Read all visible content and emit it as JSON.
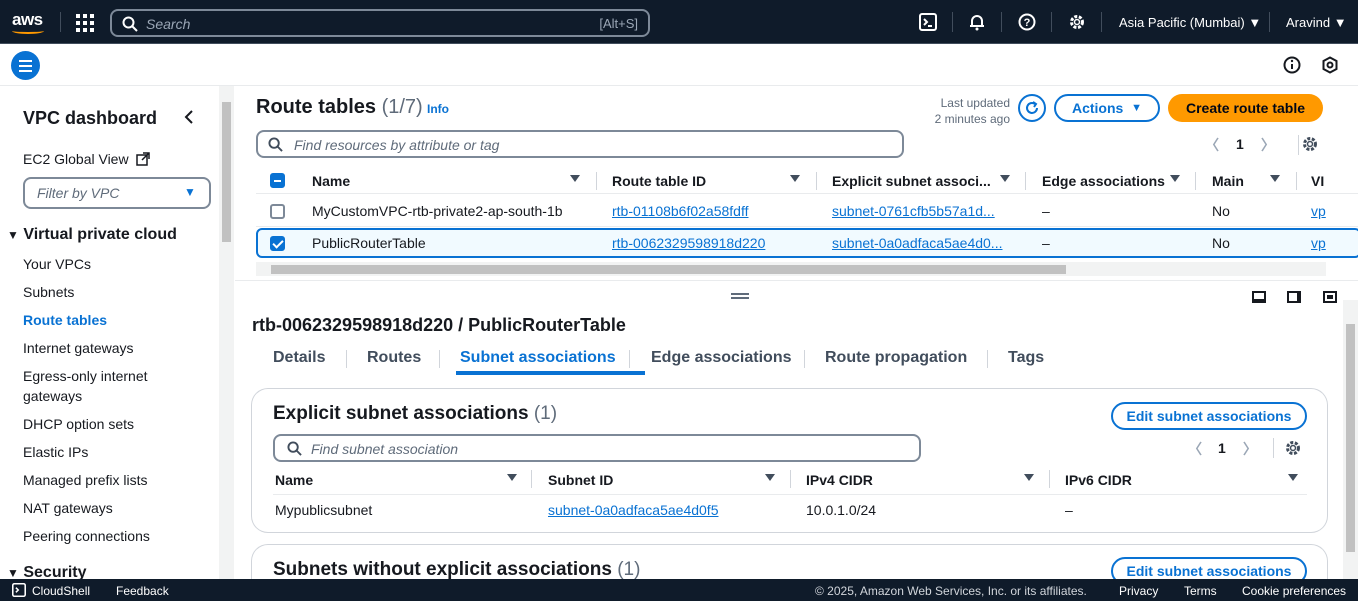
{
  "topnav": {
    "logo": "aws",
    "search_placeholder": "Search",
    "search_shortcut": "[Alt+S]",
    "region": "Asia Pacific (Mumbai)",
    "user": "Aravind",
    "icons": [
      "services-grid-icon",
      "cloudshell-icon",
      "bell-icon",
      "help-icon",
      "gear-icon"
    ]
  },
  "sidebar": {
    "title": "VPC dashboard",
    "ec2_global": "EC2 Global View",
    "filter_placeholder": "Filter by VPC",
    "section_vpc": "Virtual private cloud",
    "items": [
      "Your VPCs",
      "Subnets",
      "Route tables",
      "Internet gateways",
      "Egress-only internet",
      "gateways",
      "DHCP option sets",
      "Elastic IPs",
      "Managed prefix lists",
      "NAT gateways",
      "Peering connections"
    ],
    "active": "Route tables",
    "section_security": "Security"
  },
  "route_tables": {
    "title": "Route tables",
    "count": "(1/7)",
    "info": "Info",
    "last_updated_1": "Last updated",
    "last_updated_2": "2 minutes ago",
    "actions": "Actions",
    "create": "Create route table",
    "search_placeholder": "Find resources by attribute or tag",
    "page": "1",
    "columns": [
      "Name",
      "Route table ID",
      "Explicit subnet associ...",
      "Edge associations",
      "Main",
      "VI"
    ],
    "rows": [
      {
        "name": "MyCustomVPC-rtb-private2-ap-south-1b",
        "id": "rtb-01108b6f02a58fdff",
        "subnet": "subnet-0761cfb5b57a1d...",
        "edge": "–",
        "main": "No",
        "vpc": "vp"
      },
      {
        "name": "PublicRouterTable",
        "id": "rtb-0062329598918d220",
        "subnet": "subnet-0a0adfaca5ae4d0...",
        "edge": "–",
        "main": "No",
        "vpc": "vp"
      }
    ]
  },
  "detail": {
    "title": "rtb-0062329598918d220 / PublicRouterTable",
    "tabs": [
      "Details",
      "Routes",
      "Subnet associations",
      "Edge associations",
      "Route propagation",
      "Tags"
    ],
    "active_tab": "Subnet associations",
    "explicit": {
      "title": "Explicit subnet associations",
      "count": "(1)",
      "edit": "Edit subnet associations",
      "search_placeholder": "Find subnet association",
      "page": "1",
      "columns": [
        "Name",
        "Subnet ID",
        "IPv4 CIDR",
        "IPv6 CIDR"
      ],
      "rows": [
        {
          "name": "Mypublicsubnet",
          "subnet": "subnet-0a0adfaca5ae4d0f5",
          "ipv4": "10.0.1.0/24",
          "ipv6": "–"
        }
      ]
    },
    "without": {
      "title": "Subnets without explicit associations",
      "count": "(1)",
      "edit": "Edit subnet associations"
    }
  },
  "footer": {
    "cloudshell": "CloudShell",
    "feedback": "Feedback",
    "copyright": "© 2025, Amazon Web Services, Inc. or its affiliates.",
    "privacy": "Privacy",
    "terms": "Terms",
    "cookies": "Cookie preferences"
  }
}
